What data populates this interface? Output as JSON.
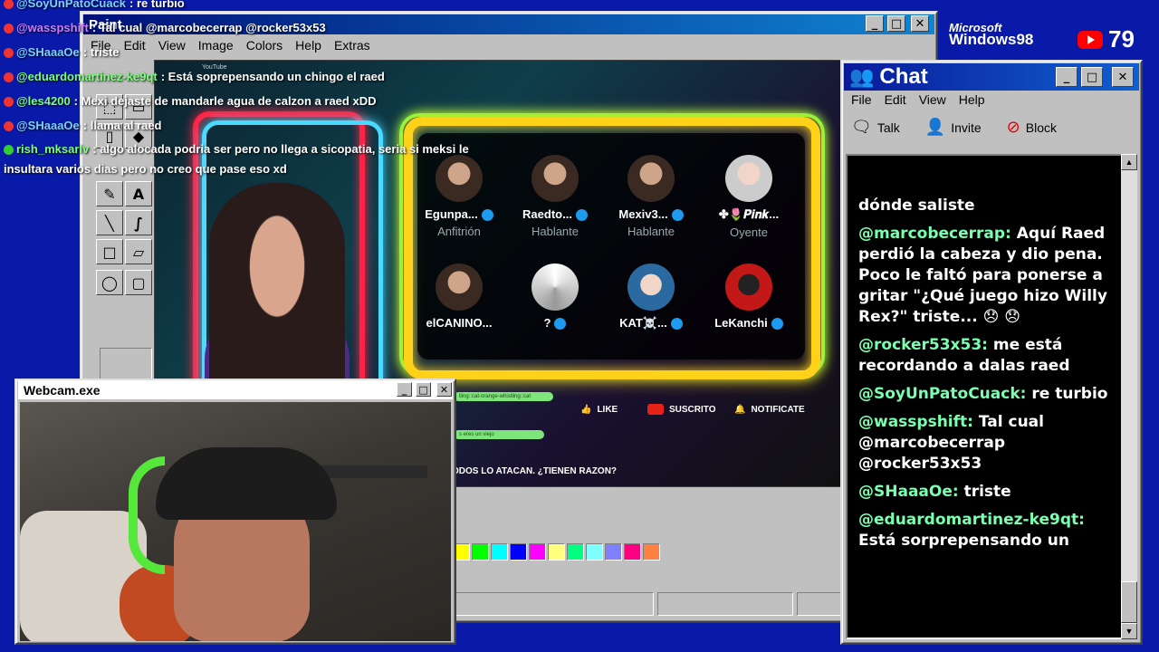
{
  "paint": {
    "title": "Paint",
    "menu": [
      "File",
      "Edit",
      "View",
      "Image",
      "Colors",
      "Help",
      "Extras"
    ],
    "palette_colors": [
      "#ffff00",
      "#00ff00",
      "#00ffff",
      "#0000ff",
      "#ff00ff",
      "#ffff80",
      "#00ff80",
      "#80ffff",
      "#8080ff",
      "#ff0080",
      "#ff8040"
    ]
  },
  "space": {
    "participants": [
      {
        "name": "Egunpa...",
        "role": "Anfitrión",
        "verified": true
      },
      {
        "name": "Raedto...",
        "role": "Hablante",
        "verified": true
      },
      {
        "name": "Mexiv3...",
        "role": "Hablante",
        "verified": true
      },
      {
        "name": "✤🌷𝑷𝒊𝒏𝒌...",
        "role": "Oyente",
        "verified": false
      },
      {
        "name": "elCANINO...",
        "role": "",
        "verified": false
      },
      {
        "name": "?",
        "role": "",
        "verified": true
      },
      {
        "name": "KAT☠️...",
        "role": "",
        "verified": true
      },
      {
        "name": "LeKanchi",
        "role": "",
        "verified": true
      }
    ],
    "like": "LIKE",
    "subscribed": "SUSCRITO",
    "notify": "NOTIFICATE",
    "caption": "ODOS LO ATACAN. ¿TIENEN RAZON?",
    "youtube_label": "YouTube"
  },
  "webcam": {
    "title": "Webcam.exe"
  },
  "chat": {
    "title": "Chat",
    "menu": [
      "File",
      "Edit",
      "View",
      "Help"
    ],
    "toolbar": {
      "talk": "Talk",
      "invite": "Invite",
      "block": "Block"
    },
    "messages": [
      {
        "user": "",
        "text": "dónde saliste"
      },
      {
        "user": "@marcobecerrap:",
        "text": "Aquí Raed perdió la cabeza y dio pena. Poco le faltó para ponerse a gritar \"¿Qué juego hizo Willy Rex?\" triste... 😞 😞"
      },
      {
        "user": "@rocker53x53:",
        "text": "me está recordando a dalas raed"
      },
      {
        "user": "@SoyUnPatoCuack:",
        "text": "re turbio"
      },
      {
        "user": "@wasspshift:",
        "text": "Tal cual @marcobecerrap @rocker53x53"
      },
      {
        "user": "@SHaaaOe:",
        "text": "triste"
      },
      {
        "user": "@eduardomartinez-ke9qt:",
        "text": "Está sorprepensando un"
      }
    ]
  },
  "overlay_chat": [
    {
      "user": "@SoyUnPatoCuack",
      "text": "re turbio",
      "color": "#7ad0ff"
    },
    {
      "user": "@wasspshift",
      "text": "Tal cual @marcobecerrap @rocker53x53",
      "color": "#c77dff"
    },
    {
      "user": "@SHaaaOe",
      "text": "triste",
      "color": "#7ad0ff"
    },
    {
      "user": "@eduardomartinez-ke9qt",
      "text": "Está soprepensando un chingo el raed",
      "color": "#7aff7a"
    },
    {
      "user": "@les4200",
      "text": "Mexi dejaste de mandarle agua de calzon a raed xDD",
      "color": "#7aff7a"
    },
    {
      "user": "@SHaaaOe",
      "text": "llama al raed",
      "color": "#7ad0ff"
    },
    {
      "user": "rish_mksarlv",
      "text": "algo alocada podria ser pero no llega a sicopatia, seria si meksi le",
      "color": "#7aff7a"
    },
    {
      "user": "",
      "text": "insultara varios dias pero no creo que pase eso xd",
      "color": "#ffffff"
    }
  ],
  "badges": {
    "ms_line1": "Microsoft",
    "ms_line2": "Windows98",
    "viewers": "79"
  },
  "colors": {
    "accent": "#1084d0",
    "chat_user": "#7affb0",
    "desktop": "#0a1aa8"
  }
}
